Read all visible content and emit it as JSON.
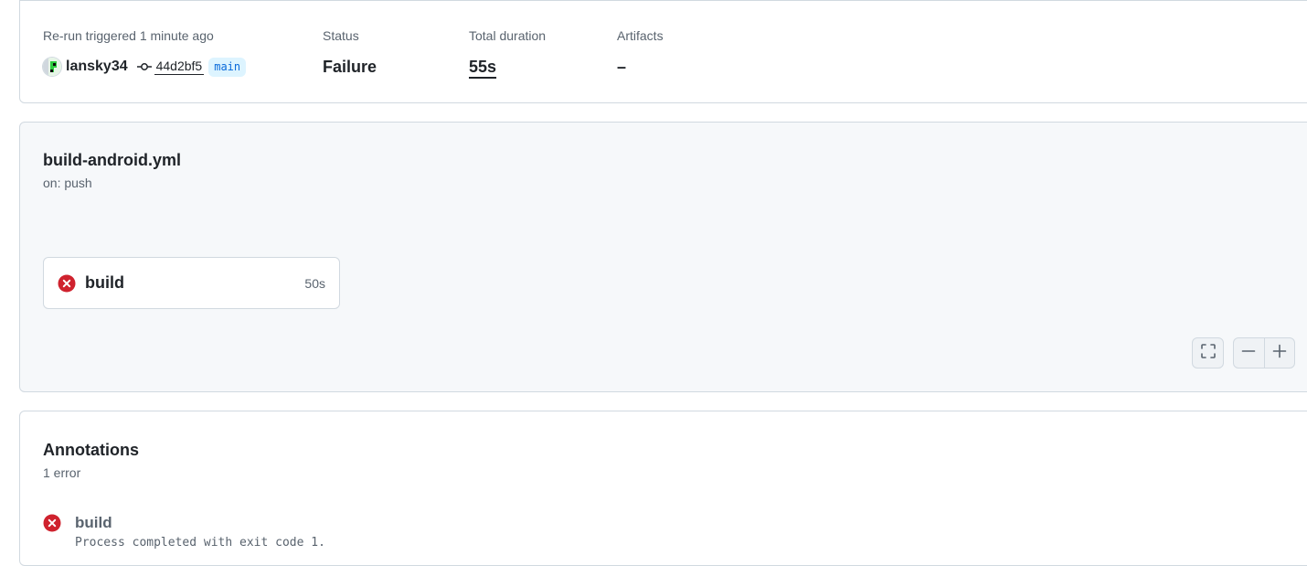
{
  "summary": {
    "trigger_label": "Re-run triggered 1 minute ago",
    "actor": "lansky34",
    "commit_sha": "44d2bf5",
    "branch": "main",
    "status_label": "Status",
    "status_value": "Failure",
    "duration_label": "Total duration",
    "duration_value": "55s",
    "artifacts_label": "Artifacts",
    "artifacts_value": "–"
  },
  "workflow": {
    "file_name": "build-android.yml",
    "trigger": "on: push",
    "jobs": [
      {
        "name": "build",
        "duration": "50s",
        "status": "failure"
      }
    ]
  },
  "annotations": {
    "title": "Annotations",
    "count": "1 error",
    "items": [
      {
        "job": "build",
        "message": "Process completed with exit code 1.",
        "severity": "error"
      }
    ]
  },
  "icons": {
    "failure": "x-circle-fill-icon",
    "commit": "git-commit-icon",
    "fullscreen": "screen-full-icon",
    "zoom_out": "dash-icon",
    "zoom_in": "plus-icon"
  },
  "colors": {
    "failure": "#cf222e",
    "branch_text": "#0969da",
    "branch_bg": "#ddf4ff",
    "panel_bg": "#f6f8fa",
    "border": "#d1d9e0"
  }
}
